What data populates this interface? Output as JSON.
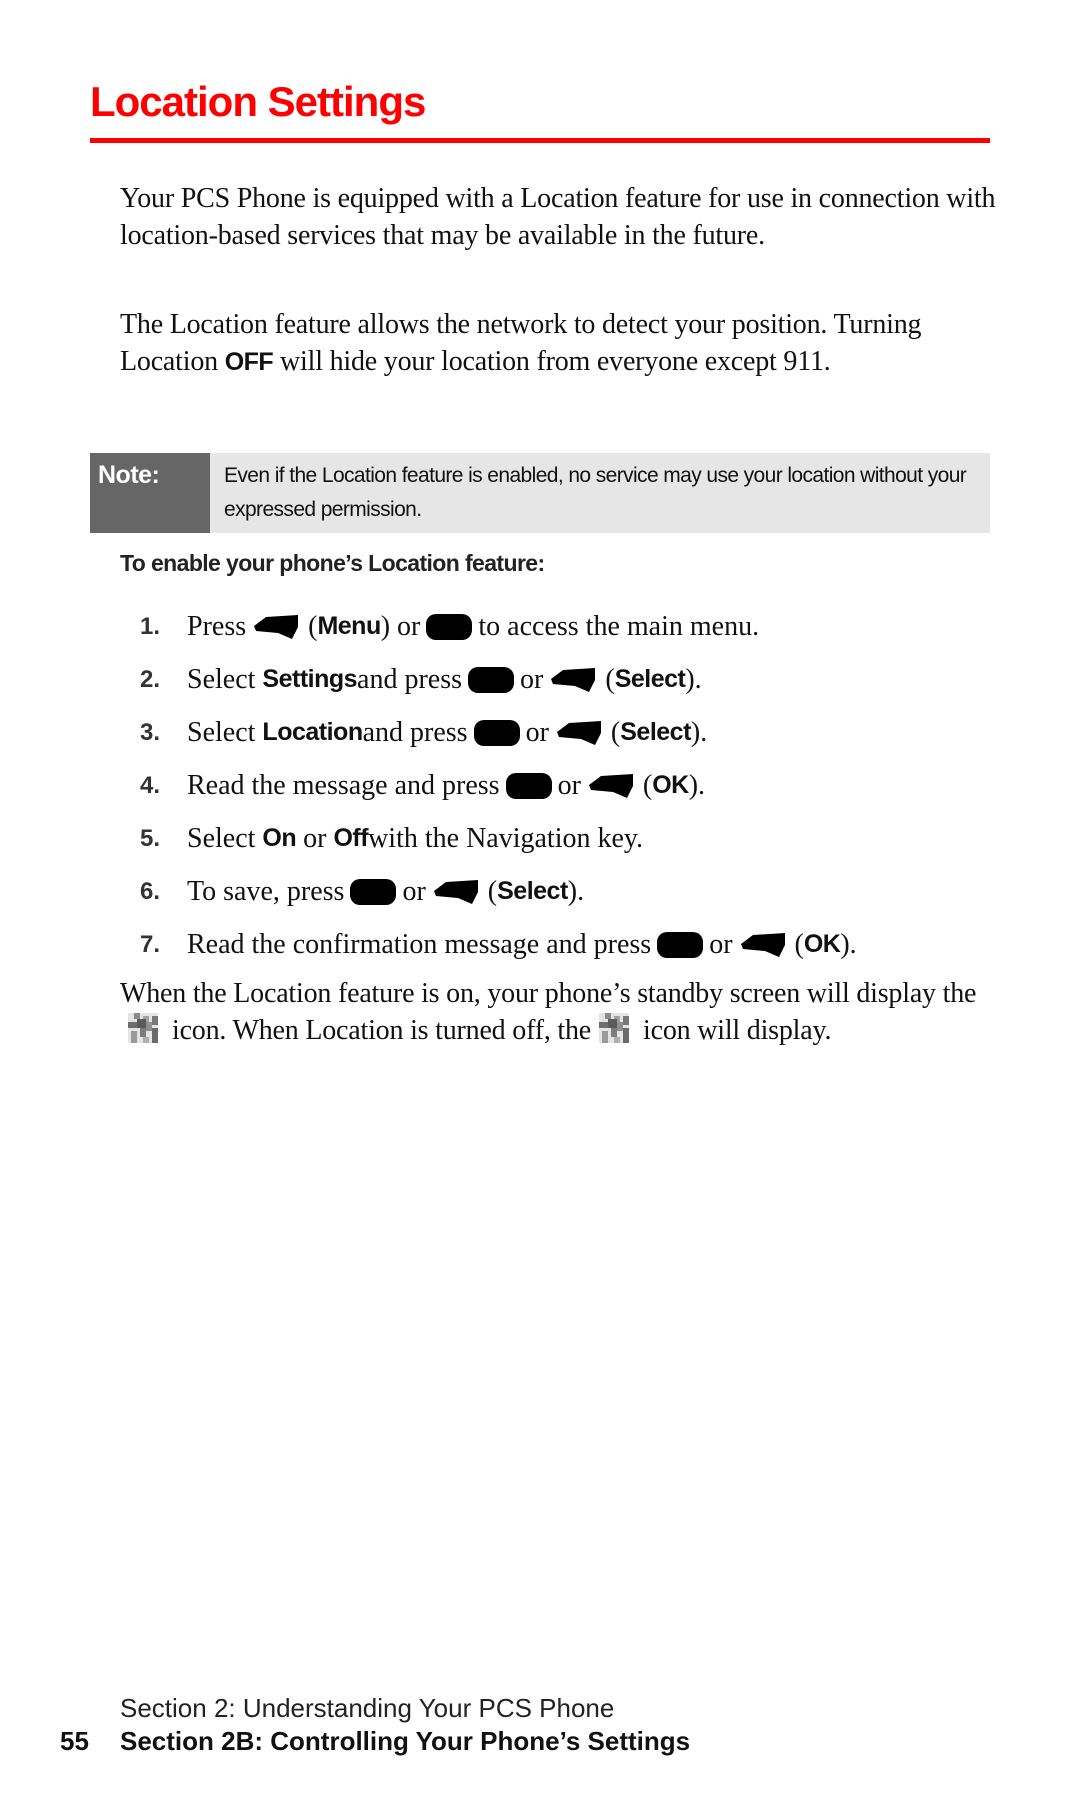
{
  "title": "Location Settings",
  "colors": {
    "accent": "#ff0000",
    "note_label_bg": "#666666",
    "note_bg": "#e6e6e6"
  },
  "intro": {
    "p1": "Your PCS Phone is equipped with a Location feature for use in connection with location-based services that may be available in the future.",
    "p2_before": "The Location feature allows the network to detect your position. Turning Location ",
    "p2_bold": "OFF",
    "p2_after": " will hide your location from everyone except 911."
  },
  "note": {
    "label": "Note:",
    "text": "Even if the Location feature is enabled, no service may use your location without your expressed permission."
  },
  "subhead": "To enable your phone’s Location feature:",
  "steps": [
    {
      "num": "1.",
      "t1": "Press",
      "t2": "(",
      "bold": "Menu",
      "t3": ") or",
      "t4": "to access the main menu."
    },
    {
      "num": "2.",
      "t1": "Select ",
      "bold1": "Settings",
      "t2": " and press",
      "t3": "or",
      "t4": "(",
      "bold2": "Select",
      "t5": ")."
    },
    {
      "num": "3.",
      "t1": "Select ",
      "bold1": "Location",
      "t2": " and press",
      "t3": "or",
      "t4": "(",
      "bold2": "Select",
      "t5": ")."
    },
    {
      "num": "4.",
      "t1": "Read the message and press",
      "t3": "or",
      "t4": "(",
      "bold2": "OK",
      "t5": ")."
    },
    {
      "num": "5.",
      "t1": "Select ",
      "bold1": "On",
      "t2": " or ",
      "bold2": "Off",
      "t3": " with the Navigation key."
    },
    {
      "num": "6.",
      "t1": "To save, press",
      "t3": "or",
      "t4": "(",
      "bold2": "Select",
      "t5": ")."
    },
    {
      "num": "7.",
      "t1": "Read the confirmation message and press",
      "t3": "or",
      "t4": "(",
      "bold2": "OK",
      "t5": ")."
    }
  ],
  "icons": {
    "menu_ok_key": "menu-ok-key-icon",
    "left_softkey": "left-softkey-icon",
    "location_on": "location-on-icon",
    "location_off": "location-off-icon"
  },
  "closing": {
    "t1": "When the Location feature is on, your phone’s standby screen will display the",
    "t2": "icon. When Location is turned off, the",
    "t3": "icon will display."
  },
  "footer": {
    "section": "Section 2: Understanding Your PCS Phone",
    "page": "55",
    "subsection": "Section 2B: Controlling Your Phone’s Settings"
  }
}
